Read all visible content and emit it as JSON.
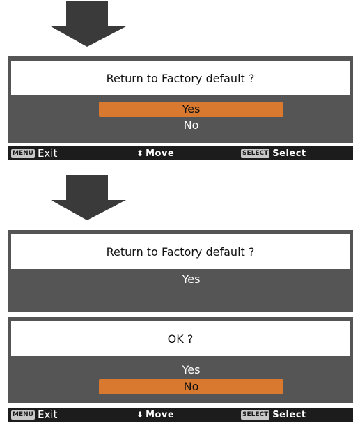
{
  "dialog1": {
    "title": "Return to Factory default ?",
    "options": [
      "Yes",
      "No"
    ],
    "selected": "Yes"
  },
  "hint1": {
    "menu_key": "MENU",
    "exit_label": "Exit",
    "move_label": "Move",
    "select_key": "SELECT",
    "select_label": "Select"
  },
  "dialog2": {
    "title": "Return to Factory default ?",
    "value": "Yes"
  },
  "dialog3": {
    "title": "OK ?",
    "options": [
      "Yes",
      "No"
    ],
    "selected": "No"
  },
  "hint2": {
    "menu_key": "MENU",
    "exit_label": "Exit",
    "move_label": "Move",
    "select_key": "SELECT",
    "select_label": "Select"
  },
  "colors": {
    "panel": "#555555",
    "highlight": "#d9782f",
    "hintbar": "#1c1c1c",
    "arrow": "#3a3a3a"
  }
}
